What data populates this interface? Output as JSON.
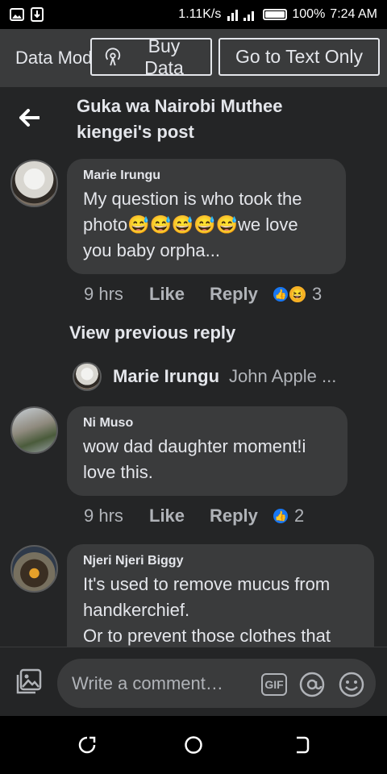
{
  "status": {
    "speed": "1.11K/s",
    "battery": "100%",
    "time": "7:24 AM"
  },
  "banner": {
    "data_mode": "Data Mode",
    "buy_data": "Buy Data",
    "text_only": "Go to Text Only"
  },
  "header": {
    "title_line1": "Guka wa Nairobi Muthee",
    "title_line2": "kiengei's post"
  },
  "comments": [
    {
      "author": "Marie Irungu",
      "text": "My question is who took the photo😅😅😅😅😅we love you baby orpha...",
      "time": "9 hrs",
      "like": "Like",
      "reply": "Reply",
      "reaction_count": "3"
    },
    {
      "author": "Ni  Muso",
      "text": "wow dad daughter moment!i love this.",
      "time": "9 hrs",
      "like": "Like",
      "reply": "Reply",
      "reaction_count": "2"
    },
    {
      "author": "Njeri Njeri Biggy",
      "text_line1": "It's used to remove mucus from handkerchief.",
      "text_line2": "Or to prevent those clothes that"
    }
  ],
  "view_previous": "View previous reply",
  "reply_preview": {
    "name": "Marie Irungu",
    "snippet": "John Apple ..."
  },
  "composer": {
    "placeholder": "Write a comment…",
    "gif_label": "GIF"
  }
}
